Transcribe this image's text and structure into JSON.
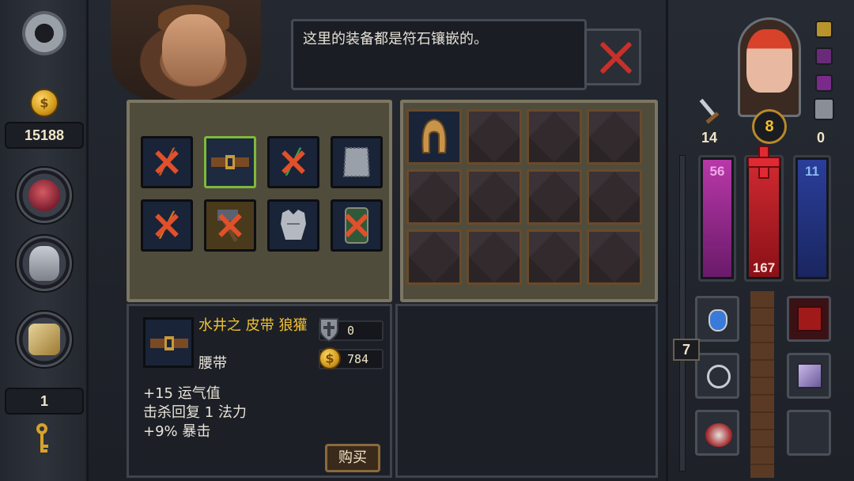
{
  "sidebar": {
    "gold": "15188",
    "keys": "1"
  },
  "dialog": {
    "text": "这里的装备都是符石镶嵌的。"
  },
  "shop": {
    "items": [
      {
        "name": "wand-icon",
        "locked": true
      },
      {
        "name": "belt-icon",
        "locked": false,
        "selected": true
      },
      {
        "name": "staff-icon",
        "locked": true
      },
      {
        "name": "chainmail-icon",
        "locked": false
      },
      {
        "name": "mace-icon",
        "locked": true
      },
      {
        "name": "hammer-icon",
        "locked": true
      },
      {
        "name": "plate-armor-icon",
        "locked": false
      },
      {
        "name": "shield-icon",
        "locked": true
      }
    ]
  },
  "inventory": {
    "slots": 12,
    "first_item": "hood-icon"
  },
  "detail": {
    "name": "水井之 皮带 狼獾",
    "type": "腰带",
    "armor": "0",
    "price": "784",
    "stats": [
      "+15 运气值",
      "击杀回复 1 法力",
      "+9% 暴击"
    ],
    "buy_label": "购买"
  },
  "hero": {
    "level": "8",
    "attack": "14",
    "defense": "0",
    "mana": "56",
    "health": "167",
    "shield": "11",
    "floor": "7"
  },
  "colors": {
    "mana": "#a82a9c",
    "health": "#c8202a",
    "shield": "#243a8a",
    "highlight": "#7fb83a",
    "gold_text": "#f0c030"
  }
}
